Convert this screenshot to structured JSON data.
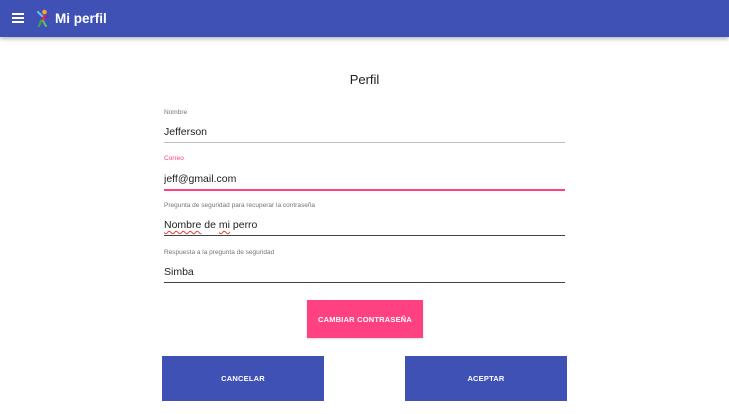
{
  "appbar": {
    "title": "Mi perfil",
    "menu_icon": "hamburger-menu-icon",
    "logo_icon": "app-logo-icon",
    "color": "#3f51b5"
  },
  "form": {
    "title": "Perfil",
    "fields": [
      {
        "label": "Nombre",
        "value": "Jefferson"
      },
      {
        "label": "Correo",
        "value": "jeff@gmail.com"
      },
      {
        "label": "Pregunta de seguridad para recuperar la contraseña",
        "value_part1": "Nombre",
        "value_part2": " de ",
        "value_part3": "mi",
        "value_part4": " perro"
      },
      {
        "label": "Respuesta a la pregunta de seguridad",
        "value": "Simba"
      }
    ],
    "accent_color": "#ff4081"
  },
  "buttons": {
    "change_password": "CAMBIAR CONTRASEÑA",
    "cancel": "CANCELAR",
    "accept": "ACEPTAR"
  }
}
